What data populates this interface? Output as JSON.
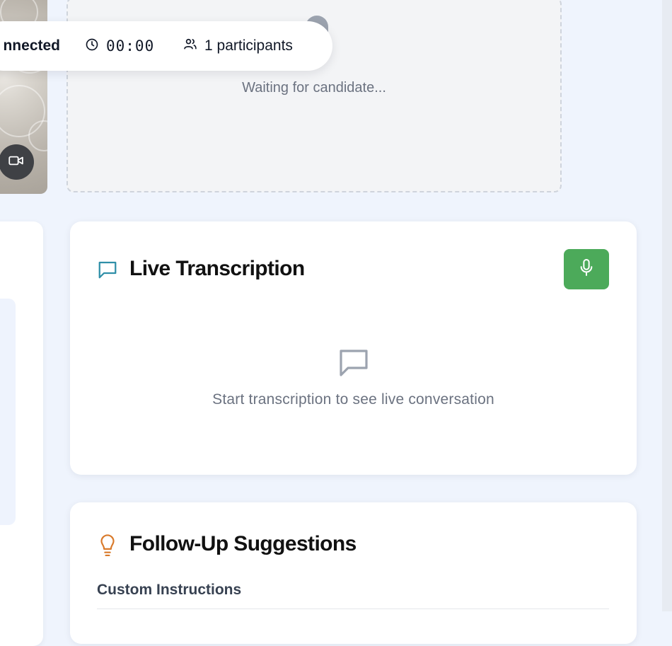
{
  "call": {
    "status": "nnected",
    "timer": "00:00",
    "participants": "1 participants",
    "icons": {
      "timer": "clock-icon",
      "participants": "users-icon",
      "camera": "video-camera-icon"
    }
  },
  "remote": {
    "waiting_text": "Waiting for candidate..."
  },
  "transcription": {
    "title": "Live Transcription",
    "empty_text": "Start transcription to see live conversation",
    "icon": "message-square-icon",
    "mic_icon": "microphone-icon",
    "accent": "#4caa5a"
  },
  "suggestions": {
    "title": "Follow-Up Suggestions",
    "custom_label": "Custom Instructions",
    "icon": "lightbulb-icon",
    "accent": "#d97a2b"
  }
}
